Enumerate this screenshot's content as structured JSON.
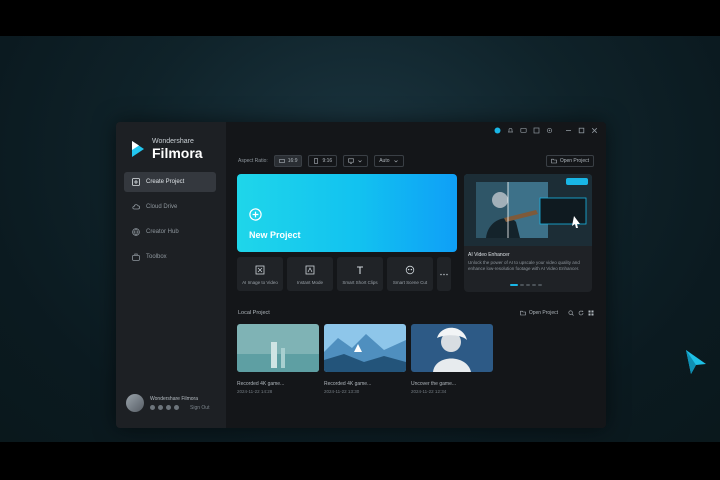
{
  "app": {
    "brand_sub": "Wondershare",
    "brand_name": "Filmora"
  },
  "sidebar": {
    "items": [
      {
        "label": "Create Project",
        "icon": "plus-square-icon",
        "active": true
      },
      {
        "label": "Cloud Drive",
        "icon": "cloud-icon",
        "active": false
      },
      {
        "label": "Creator Hub",
        "icon": "globe-icon",
        "active": false
      },
      {
        "label": "Toolbox",
        "icon": "toolbox-icon",
        "active": false
      }
    ],
    "user": {
      "name": "Wondershare Filmora",
      "signout": "Sign Out"
    }
  },
  "toolbar": {
    "ratio_label": "Aspect Ratio:",
    "ratio_value": "16:9",
    "orientation_value": "9:16",
    "preset_value": "",
    "mode_value": "Auto",
    "open_project": "Open Project"
  },
  "new_project": {
    "label": "New Project"
  },
  "promo": {
    "title": "AI Video Enhancer",
    "desc": "Unlock the power of AI to upscale your video quality and enhance low-resolution footage with AI Video Enhancer."
  },
  "tools": [
    {
      "label": "AI Image to Video",
      "icon": "image-to-video-icon"
    },
    {
      "label": "Instant Mode",
      "icon": "instant-mode-icon"
    },
    {
      "label": "Smart Short Clips",
      "icon": "text-t-icon"
    },
    {
      "label": "Smart Scene Cut",
      "icon": "scene-cut-icon"
    }
  ],
  "recent": {
    "title": "Local Project",
    "open_label": "Open Project",
    "items": [
      {
        "name": "Recorded 4K game...",
        "meta": "2024-11-22 14:28"
      },
      {
        "name": "Recorded 4K game...",
        "meta": "2024-11-22 13:30"
      },
      {
        "name": "Uncover the game...",
        "meta": "2024-11-22 12:34"
      }
    ]
  },
  "colors": {
    "accent": "#19b6e6",
    "new_project_start": "#1fd6ea",
    "new_project_end": "#0f9ff7",
    "window_bg": "#16181b"
  }
}
